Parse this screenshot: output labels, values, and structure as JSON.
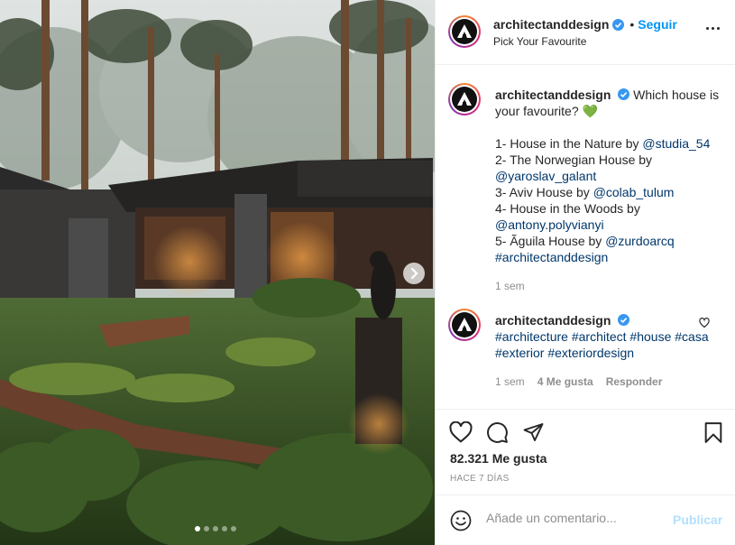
{
  "post": {
    "username": "architectanddesign",
    "follow_separator": "•",
    "follow_label": "Seguir",
    "location": "Pick Your Favourite",
    "more_icon": "more-horizontal-icon"
  },
  "caption": {
    "username": "architectanddesign",
    "text_line1": "Which house is your favourite?",
    "emoji": "💚",
    "items": [
      {
        "prefix": "1- House in the Nature by ",
        "mention": "@studia_54"
      },
      {
        "prefix": "2- The Norwegian House by ",
        "mention": "@yaroslav_galant"
      },
      {
        "prefix": "3- Aviv House by ",
        "mention": "@colab_tulum"
      },
      {
        "prefix": "4- House in the Woods by ",
        "mention": "@antony.polyvianyi"
      },
      {
        "prefix": "5- Ãguila House by ",
        "mention": "@zurdoarcq"
      }
    ],
    "hashtag": "#architectanddesign",
    "time": "1 sem"
  },
  "comment": {
    "username": "architectanddesign",
    "tags": [
      "#architecture",
      "#architect",
      "#house",
      "#casa",
      "#exterior",
      "#exteriordesign"
    ],
    "time": "1 sem",
    "likes": "4 Me gusta",
    "reply": "Responder"
  },
  "actions": {
    "icons": [
      "heart-icon",
      "comment-icon",
      "share-icon",
      "bookmark-icon"
    ],
    "likes_count": "82.321 Me gusta",
    "date": "HACE 7 DÍAS"
  },
  "add_comment": {
    "placeholder": "Añade un comentario...",
    "publish_label": "Publicar"
  },
  "carousel": {
    "slides": 5,
    "active_index": 0
  },
  "colors": {
    "link": "#00376b",
    "follow": "#0095f6",
    "publish_disabled": "#b2dffc",
    "muted": "#8e8e8e",
    "text": "#262626"
  }
}
